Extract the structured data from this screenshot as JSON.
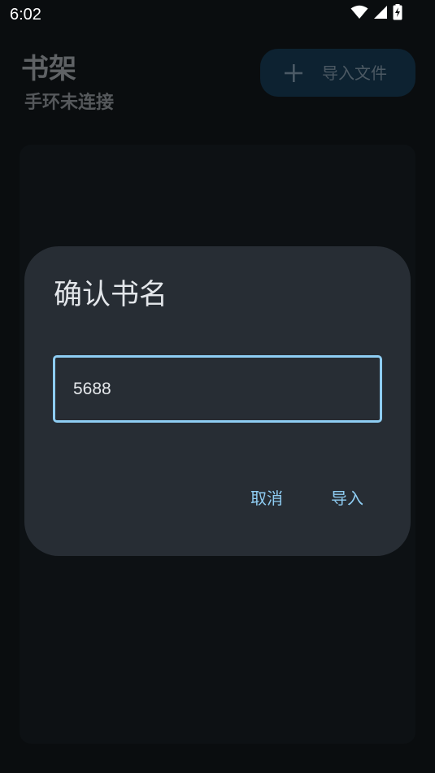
{
  "status_bar": {
    "time": "6:02",
    "icons": [
      "wifi-icon",
      "cellular-signal-icon",
      "battery-charging-icon"
    ]
  },
  "header": {
    "title": "书架",
    "subtitle": "手环未连接",
    "import_button_label": "导入文件",
    "import_button_icon": "plus-icon"
  },
  "dialog": {
    "title": "确认书名",
    "input_value": "5688",
    "cancel_label": "取消",
    "confirm_label": "导入"
  },
  "colors": {
    "background": "#0a0d0f",
    "dialog_background": "#272d34",
    "accent": "#8ecdf3",
    "import_button_background": "#0d2231"
  }
}
